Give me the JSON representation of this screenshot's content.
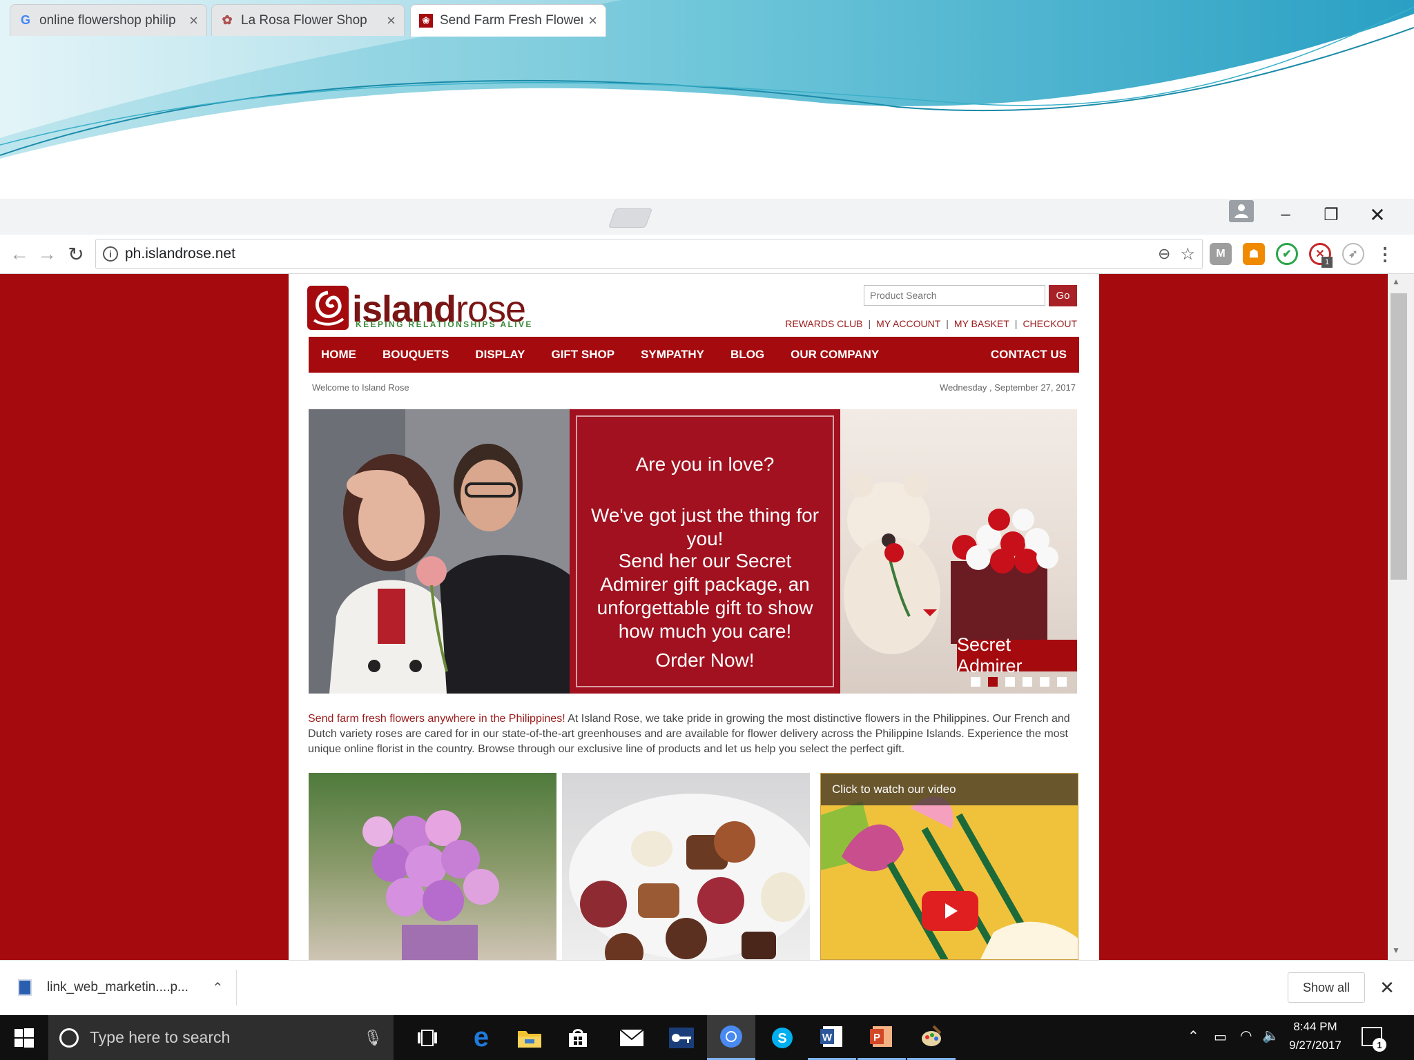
{
  "browser": {
    "tabs": [
      {
        "title": "online flowershop philip",
        "icon": "google-g-icon"
      },
      {
        "title": "La Rosa Flower Shop",
        "icon": "rose-favicon-icon"
      },
      {
        "title": "Send Farm Fresh Flowers",
        "icon": "islandrose-favicon-icon"
      }
    ],
    "url": "ph.islandrose.net",
    "extensions": [
      "M",
      "cookie-icon",
      "shield-icon",
      "block-icon",
      "rocket-icon"
    ],
    "extension_badge": "1"
  },
  "site": {
    "logo_main": "island",
    "logo_light": "rose",
    "tagline": "KEEPING RELATIONSHIPS ALIVE",
    "search_placeholder": "Product Search",
    "search_button": "Go",
    "top_links": [
      "REWARDS CLUB",
      "MY ACCOUNT",
      "MY BASKET",
      "CHECKOUT"
    ],
    "nav": [
      "HOME",
      "BOUQUETS",
      "DISPLAY",
      "GIFT SHOP",
      "SYMPATHY",
      "BLOG",
      "OUR COMPANY"
    ],
    "nav_right": "CONTACT US",
    "welcome": "Welcome to Island Rose",
    "date": "Wednesday , September 27, 2017",
    "hero": {
      "line1": "Are you in love?",
      "line2": "We've got just the thing for you!",
      "line3": "Send her our Secret Admirer gift package, an unforgettable gift to show how much you care!",
      "cta": "Order Now!",
      "label": "Secret Admirer",
      "slide_count": 6,
      "active_slide": 2
    },
    "intro_lead": "Send farm fresh flowers anywhere in the Philippines!",
    "intro_body": " At Island Rose, we take pride in growing the most distinctive flowers in the Philippines. Our French and Dutch variety roses are cared for in our state-of-the-art greenhouses and are available for flower delivery across the Philippine Islands. Experience the most unique online florist in the country. Browse through our exclusive line of products and let us help you select the perfect gift.",
    "video_caption": "Click to watch our video"
  },
  "downloads": {
    "file": "link_web_marketin....p...",
    "show_all": "Show all"
  },
  "taskbar": {
    "search_placeholder": "Type here to search",
    "time": "8:44 PM",
    "date": "9/27/2017",
    "notification_count": "1"
  },
  "colors": {
    "brand_red": "#a50b0e",
    "tagline_green": "#3a8a3a"
  }
}
